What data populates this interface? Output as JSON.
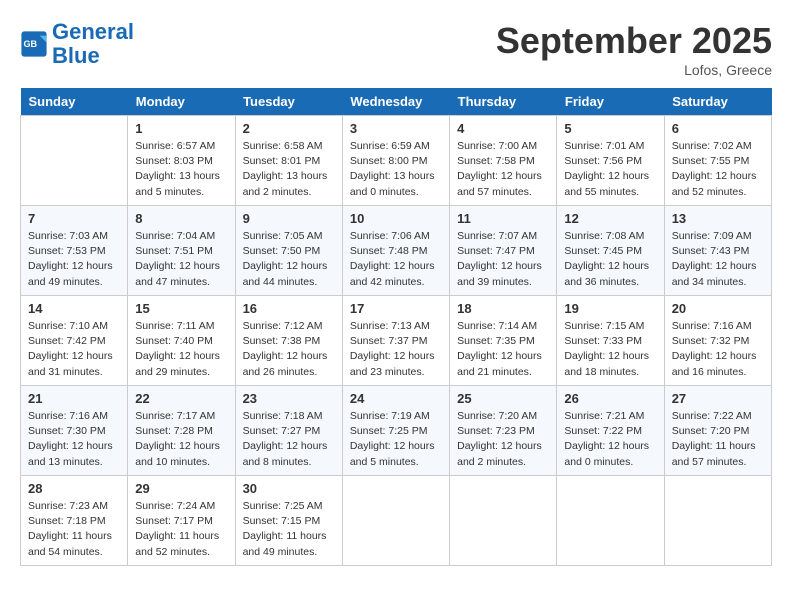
{
  "header": {
    "logo_line1": "General",
    "logo_line2": "Blue",
    "month_year": "September 2025",
    "location": "Lofos, Greece"
  },
  "days_of_week": [
    "Sunday",
    "Monday",
    "Tuesday",
    "Wednesday",
    "Thursday",
    "Friday",
    "Saturday"
  ],
  "weeks": [
    [
      {
        "day": "",
        "info": ""
      },
      {
        "day": "1",
        "info": "Sunrise: 6:57 AM\nSunset: 8:03 PM\nDaylight: 13 hours\nand 5 minutes."
      },
      {
        "day": "2",
        "info": "Sunrise: 6:58 AM\nSunset: 8:01 PM\nDaylight: 13 hours\nand 2 minutes."
      },
      {
        "day": "3",
        "info": "Sunrise: 6:59 AM\nSunset: 8:00 PM\nDaylight: 13 hours\nand 0 minutes."
      },
      {
        "day": "4",
        "info": "Sunrise: 7:00 AM\nSunset: 7:58 PM\nDaylight: 12 hours\nand 57 minutes."
      },
      {
        "day": "5",
        "info": "Sunrise: 7:01 AM\nSunset: 7:56 PM\nDaylight: 12 hours\nand 55 minutes."
      },
      {
        "day": "6",
        "info": "Sunrise: 7:02 AM\nSunset: 7:55 PM\nDaylight: 12 hours\nand 52 minutes."
      }
    ],
    [
      {
        "day": "7",
        "info": "Sunrise: 7:03 AM\nSunset: 7:53 PM\nDaylight: 12 hours\nand 49 minutes."
      },
      {
        "day": "8",
        "info": "Sunrise: 7:04 AM\nSunset: 7:51 PM\nDaylight: 12 hours\nand 47 minutes."
      },
      {
        "day": "9",
        "info": "Sunrise: 7:05 AM\nSunset: 7:50 PM\nDaylight: 12 hours\nand 44 minutes."
      },
      {
        "day": "10",
        "info": "Sunrise: 7:06 AM\nSunset: 7:48 PM\nDaylight: 12 hours\nand 42 minutes."
      },
      {
        "day": "11",
        "info": "Sunrise: 7:07 AM\nSunset: 7:47 PM\nDaylight: 12 hours\nand 39 minutes."
      },
      {
        "day": "12",
        "info": "Sunrise: 7:08 AM\nSunset: 7:45 PM\nDaylight: 12 hours\nand 36 minutes."
      },
      {
        "day": "13",
        "info": "Sunrise: 7:09 AM\nSunset: 7:43 PM\nDaylight: 12 hours\nand 34 minutes."
      }
    ],
    [
      {
        "day": "14",
        "info": "Sunrise: 7:10 AM\nSunset: 7:42 PM\nDaylight: 12 hours\nand 31 minutes."
      },
      {
        "day": "15",
        "info": "Sunrise: 7:11 AM\nSunset: 7:40 PM\nDaylight: 12 hours\nand 29 minutes."
      },
      {
        "day": "16",
        "info": "Sunrise: 7:12 AM\nSunset: 7:38 PM\nDaylight: 12 hours\nand 26 minutes."
      },
      {
        "day": "17",
        "info": "Sunrise: 7:13 AM\nSunset: 7:37 PM\nDaylight: 12 hours\nand 23 minutes."
      },
      {
        "day": "18",
        "info": "Sunrise: 7:14 AM\nSunset: 7:35 PM\nDaylight: 12 hours\nand 21 minutes."
      },
      {
        "day": "19",
        "info": "Sunrise: 7:15 AM\nSunset: 7:33 PM\nDaylight: 12 hours\nand 18 minutes."
      },
      {
        "day": "20",
        "info": "Sunrise: 7:16 AM\nSunset: 7:32 PM\nDaylight: 12 hours\nand 16 minutes."
      }
    ],
    [
      {
        "day": "21",
        "info": "Sunrise: 7:16 AM\nSunset: 7:30 PM\nDaylight: 12 hours\nand 13 minutes."
      },
      {
        "day": "22",
        "info": "Sunrise: 7:17 AM\nSunset: 7:28 PM\nDaylight: 12 hours\nand 10 minutes."
      },
      {
        "day": "23",
        "info": "Sunrise: 7:18 AM\nSunset: 7:27 PM\nDaylight: 12 hours\nand 8 minutes."
      },
      {
        "day": "24",
        "info": "Sunrise: 7:19 AM\nSunset: 7:25 PM\nDaylight: 12 hours\nand 5 minutes."
      },
      {
        "day": "25",
        "info": "Sunrise: 7:20 AM\nSunset: 7:23 PM\nDaylight: 12 hours\nand 2 minutes."
      },
      {
        "day": "26",
        "info": "Sunrise: 7:21 AM\nSunset: 7:22 PM\nDaylight: 12 hours\nand 0 minutes."
      },
      {
        "day": "27",
        "info": "Sunrise: 7:22 AM\nSunset: 7:20 PM\nDaylight: 11 hours\nand 57 minutes."
      }
    ],
    [
      {
        "day": "28",
        "info": "Sunrise: 7:23 AM\nSunset: 7:18 PM\nDaylight: 11 hours\nand 54 minutes."
      },
      {
        "day": "29",
        "info": "Sunrise: 7:24 AM\nSunset: 7:17 PM\nDaylight: 11 hours\nand 52 minutes."
      },
      {
        "day": "30",
        "info": "Sunrise: 7:25 AM\nSunset: 7:15 PM\nDaylight: 11 hours\nand 49 minutes."
      },
      {
        "day": "",
        "info": ""
      },
      {
        "day": "",
        "info": ""
      },
      {
        "day": "",
        "info": ""
      },
      {
        "day": "",
        "info": ""
      }
    ]
  ]
}
